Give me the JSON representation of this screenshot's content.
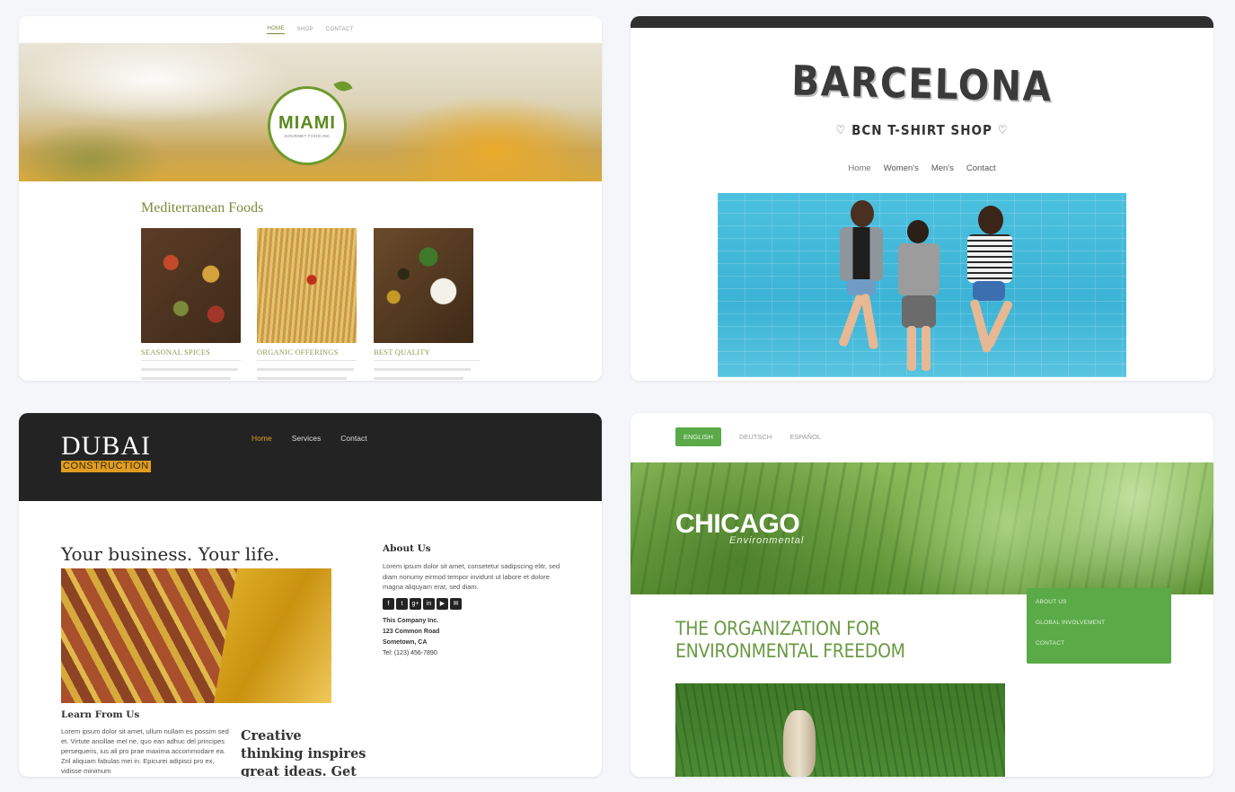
{
  "cards": {
    "miami": {
      "nav": [
        "HOME",
        "SHOP",
        "CONTACT"
      ],
      "logo": "MIAMI",
      "logo_sub": "GOURMET FOOD INC",
      "heading": "Mediterranean Foods",
      "items": [
        "SEASONAL SPICES",
        "ORGANIC OFFERINGS",
        "BEST QUALITY"
      ]
    },
    "barcelona": {
      "title": "BARCELONA",
      "subtitle": "BCN T-SHIRT SHOP",
      "nav": [
        "Home",
        "Women's",
        "Men's",
        "Contact"
      ]
    },
    "dubai": {
      "logo": "DUBAI",
      "logo_sub": "CONSTRUCTION",
      "nav": [
        "Home",
        "Services",
        "Contact"
      ],
      "heading": "Your business. Your life.",
      "learn_heading": "Learn From Us",
      "learn_text": "Lorem ipsum dolor sit amet, ullum nullam es possim sed et. Virtute ancillae mel ne, quo ean adhuc del principes persequeris, ius ali pro prae maxima accommodare ea. Zril aliquam fabulas mei in. Epicurei adipisci pro ex, vidisse minimum",
      "quote": "Creative thinking inspires great ideas. Get",
      "about_heading": "About Us",
      "about_text": "Lorem ipsum dolor sit amet, consetetur sadipscing elitr, sed diam nonumy eirmod tempor invidunt ut labore et dolore magna aliquyam erat, sed diam.",
      "social": [
        "f",
        "t",
        "g+",
        "in",
        "▶",
        "✉"
      ],
      "address": {
        "company": "This Company Inc.",
        "street": "123 Common Road",
        "city": "Sometown, CA",
        "phone": "Tel: (123) 456-7890"
      }
    },
    "chicago": {
      "languages": [
        "ENGLISH",
        "DEUTSCH",
        "ESPAÑOL"
      ],
      "logo": "CHICAGO",
      "logo_sub": "Environmental",
      "menu": [
        "ABOUT US",
        "GLOBAL INVOLVEMENT",
        "CONTACT"
      ],
      "heading": "THE ORGANIZATION FOR ENVIRONMENTAL FREEDOM"
    }
  },
  "colors": {
    "page_bg": "#f4f6f9",
    "miami_green": "#7c8b3b",
    "dubai_dark": "#232323",
    "dubai_accent": "#e09d22",
    "chicago_green": "#5aaa48"
  }
}
